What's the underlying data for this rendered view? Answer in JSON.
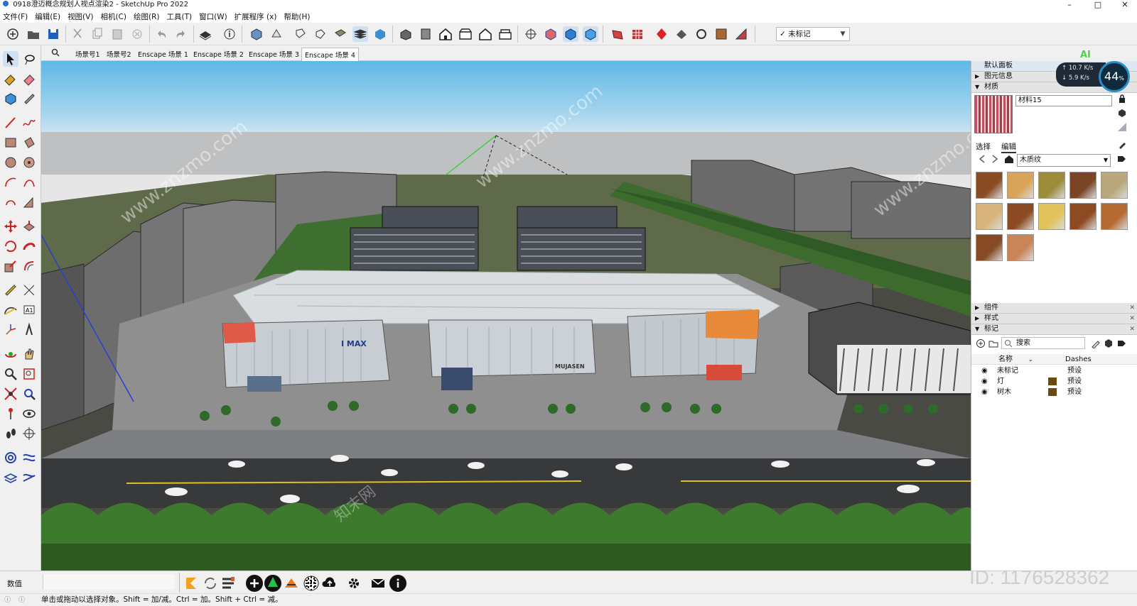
{
  "window": {
    "title": "0918澄迈概念规划人视点渲染2 - SketchUp Pro 2022",
    "controls": [
      "–",
      "□",
      "✕"
    ]
  },
  "menu": [
    "文件(F)",
    "编辑(E)",
    "视图(V)",
    "相机(C)",
    "绘图(R)",
    "工具(T)",
    "窗口(W)",
    "扩展程序 (x)",
    "帮助(H)"
  ],
  "toolbar": {
    "tag_select_value": "未标记",
    "tag_select_check": "✓"
  },
  "scenes": {
    "tabs": [
      "场景号1",
      "场景号2",
      "Enscape 场景 1",
      "Enscape 场景 2",
      "Enscape 场景 3",
      "Enscape 场景 4"
    ],
    "active_index": 5
  },
  "viewport": {
    "signage": [
      "I MAX",
      "MUJASEN"
    ],
    "watermarks": [
      "www.znzmo.com",
      "知末网"
    ]
  },
  "panel": {
    "title": "默认面板",
    "sections": {
      "entity_info": "图元信息",
      "materials": "材质",
      "components": "组件",
      "styles": "样式",
      "tags": "标记"
    },
    "material_name": "材料15",
    "tabs": [
      "选择",
      "编辑"
    ],
    "library": "木质纹",
    "swatch_colors": [
      "#8a4a22",
      "#d9a45a",
      "#9c8c3a",
      "#7a4526",
      "#b9a77c",
      "#d8b47c",
      "#8c4a24",
      "#e0c35c",
      "#8e4a22",
      "#b46a30",
      "#874a24",
      "#c98458"
    ],
    "tag_search_placeholder": "搜索",
    "tag_columns": [
      "名称",
      "Dashes"
    ],
    "tags": [
      {
        "name": "未标记",
        "dashes": "预设",
        "color": ""
      },
      {
        "name": "灯",
        "dashes": "预设",
        "color": "#6b4a12"
      },
      {
        "name": "树木",
        "dashes": "预设",
        "color": "#6b4a12"
      }
    ]
  },
  "network": {
    "up": "10.7 K/s",
    "down": "5.9 K/s",
    "percent": "44",
    "percent_unit": "%",
    "ai_label": "AI"
  },
  "status": {
    "measurements_label": "数值",
    "hint": "单击或拖动以选择对象。Shift = 加/减。Ctrl = 加。Shift + Ctrl = 减。"
  },
  "brand": {
    "logo_text": "知末",
    "id_text": "ID: 1176528362"
  }
}
